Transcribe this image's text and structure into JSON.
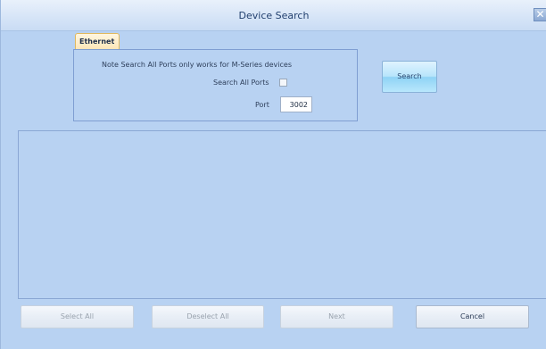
{
  "window": {
    "title": "Device Search",
    "close_glyph": "✕"
  },
  "tab": {
    "label": "Ethernet"
  },
  "ethernet": {
    "note": "Note Search All Ports only works for M-Series devices",
    "search_all_label": "Search All Ports",
    "search_all_checked": false,
    "port_label": "Port",
    "port_value": "3002",
    "search_button": "Search"
  },
  "results": {
    "items": []
  },
  "footer": {
    "select_all": "Select All",
    "deselect_all": "Deselect All",
    "next": "Next",
    "cancel": "Cancel"
  },
  "colors": {
    "background": "#b8d2f2",
    "tab": "#fde6b8",
    "search_button": "#8fd3f5"
  }
}
